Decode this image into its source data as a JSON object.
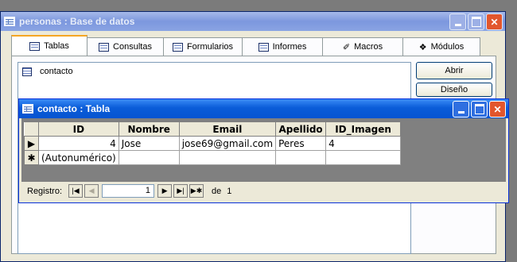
{
  "db_window": {
    "title": "personas : Base de datos",
    "tabs": [
      {
        "label": "Tablas",
        "icon": "table-icon"
      },
      {
        "label": "Consultas",
        "icon": "query-icon"
      },
      {
        "label": "Formularios",
        "icon": "form-icon"
      },
      {
        "label": "Informes",
        "icon": "report-icon"
      },
      {
        "label": "Macros",
        "icon": "macro-icon"
      },
      {
        "label": "Módulos",
        "icon": "module-icon"
      }
    ],
    "selected_tab": "Tablas",
    "objects": [
      {
        "label": "contacto",
        "icon": "table-icon"
      }
    ],
    "buttons": {
      "open": "Abrir",
      "design": "Diseño"
    }
  },
  "table_window": {
    "title": "contacto : Tabla",
    "columns": [
      "ID",
      "Nombre",
      "Email",
      "Apellido",
      "ID_Imagen"
    ],
    "rows": [
      {
        "selector": "▶",
        "ID": "4",
        "Nombre": "Jose",
        "Email": "jose69@gmail.com",
        "Apellido": "Peres",
        "ID_Imagen": "4"
      }
    ],
    "new_row": {
      "selector": "✱",
      "ID": "(Autonumérico)"
    },
    "navigator": {
      "label": "Registro:",
      "current": "1",
      "of_label": "de",
      "total": "1"
    }
  }
}
